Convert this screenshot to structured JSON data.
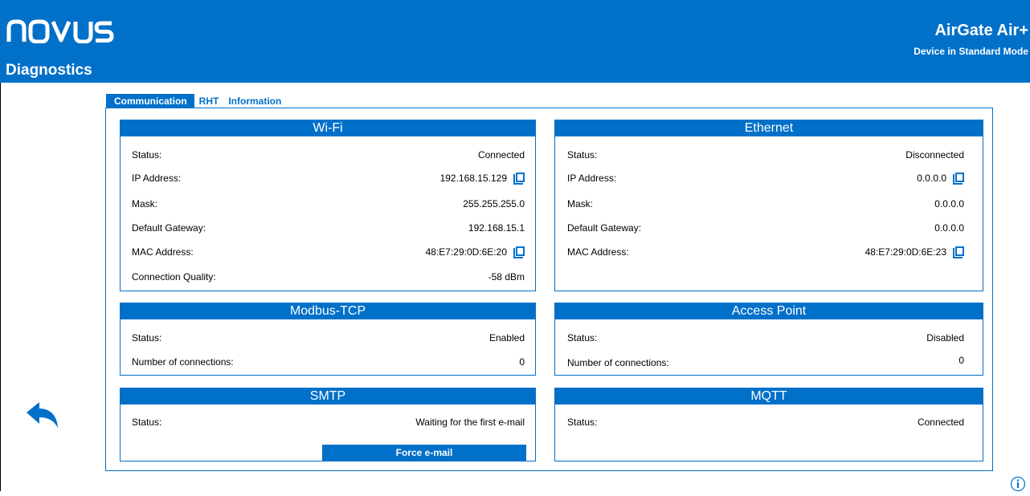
{
  "header": {
    "brand_logo": "novus",
    "page_title": "Diagnostics",
    "product_name": "AirGate Air+",
    "device_mode": "Device in Standard Mode"
  },
  "tabs": [
    {
      "label": "Communication",
      "active": true
    },
    {
      "label": "RHT",
      "active": false
    },
    {
      "label": "Information",
      "active": false
    }
  ],
  "wifi": {
    "title": "Wi-Fi",
    "status_label": "Status:",
    "status_value": "Connected",
    "ip_label": "IP Address:",
    "ip_value": "192.168.15.129",
    "mask_label": "Mask:",
    "mask_value": "255.255.255.0",
    "gateway_label": "Default Gateway:",
    "gateway_value": "192.168.15.1",
    "mac_label": "MAC Address:",
    "mac_value": "48:E7:29:0D:6E:20",
    "quality_label": "Connection Quality:",
    "quality_value": "-58 dBm"
  },
  "ethernet": {
    "title": "Ethernet",
    "status_label": "Status:",
    "status_value": "Disconnected",
    "ip_label": "IP Address:",
    "ip_value": "0.0.0.0",
    "mask_label": "Mask:",
    "mask_value": "0.0.0.0",
    "gateway_label": "Default Gateway:",
    "gateway_value": "0.0.0.0",
    "mac_label": "MAC Address:",
    "mac_value": "48:E7:29:0D:6E:23"
  },
  "modbus": {
    "title": "Modbus-TCP",
    "status_label": "Status:",
    "status_value": "Enabled",
    "connections_label": "Number of connections:",
    "connections_value": "0"
  },
  "access_point": {
    "title": "Access Point",
    "status_label": "Status:",
    "status_value": "Disabled",
    "connections_label": "Number of connections:",
    "connections_value": "0"
  },
  "smtp": {
    "title": "SMTP",
    "status_label": "Status:",
    "status_value": "Waiting for the first e-mail",
    "force_button": "Force e-mail"
  },
  "mqtt": {
    "title": "MQTT",
    "status_label": "Status:",
    "status_value": "Connected"
  },
  "icons": {
    "copy": "copy-icon",
    "back": "back-arrow-icon",
    "info": "info-icon"
  },
  "colors": {
    "primary": "#0070c9",
    "text": "#000000",
    "background": "#ffffff"
  }
}
